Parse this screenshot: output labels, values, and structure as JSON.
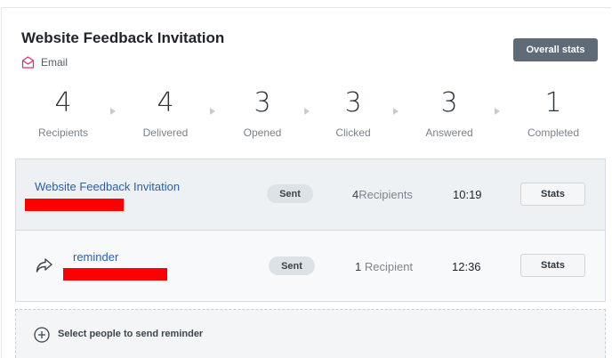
{
  "campaign": {
    "title": "Website Feedback Invitation",
    "channel": "Email",
    "overall_stats_label": "Overall stats"
  },
  "funnel": [
    {
      "value": "4",
      "label": "Recipients"
    },
    {
      "value": "4",
      "label": "Delivered"
    },
    {
      "value": "3",
      "label": "Opened"
    },
    {
      "value": "3",
      "label": "Clicked"
    },
    {
      "value": "3",
      "label": "Answered"
    },
    {
      "value": "1",
      "label": "Completed"
    }
  ],
  "messages": [
    {
      "title": "Website Feedback Invitation",
      "status": "Sent",
      "recipients_count": "4",
      "recipients_label": "Recipients",
      "time": "10:19",
      "stats_label": "Stats"
    },
    {
      "title": "reminder",
      "status": "Sent",
      "recipients_count": "1",
      "recipients_label": "Recipient",
      "time": "12:36",
      "stats_label": "Stats"
    }
  ],
  "add_reminder": {
    "label": "Select people to send reminder"
  },
  "colors": {
    "accent": "#2a5fa8",
    "email_icon": "#d6337a",
    "redaction": "#ff0000",
    "button_dark": "#5f6b77"
  }
}
